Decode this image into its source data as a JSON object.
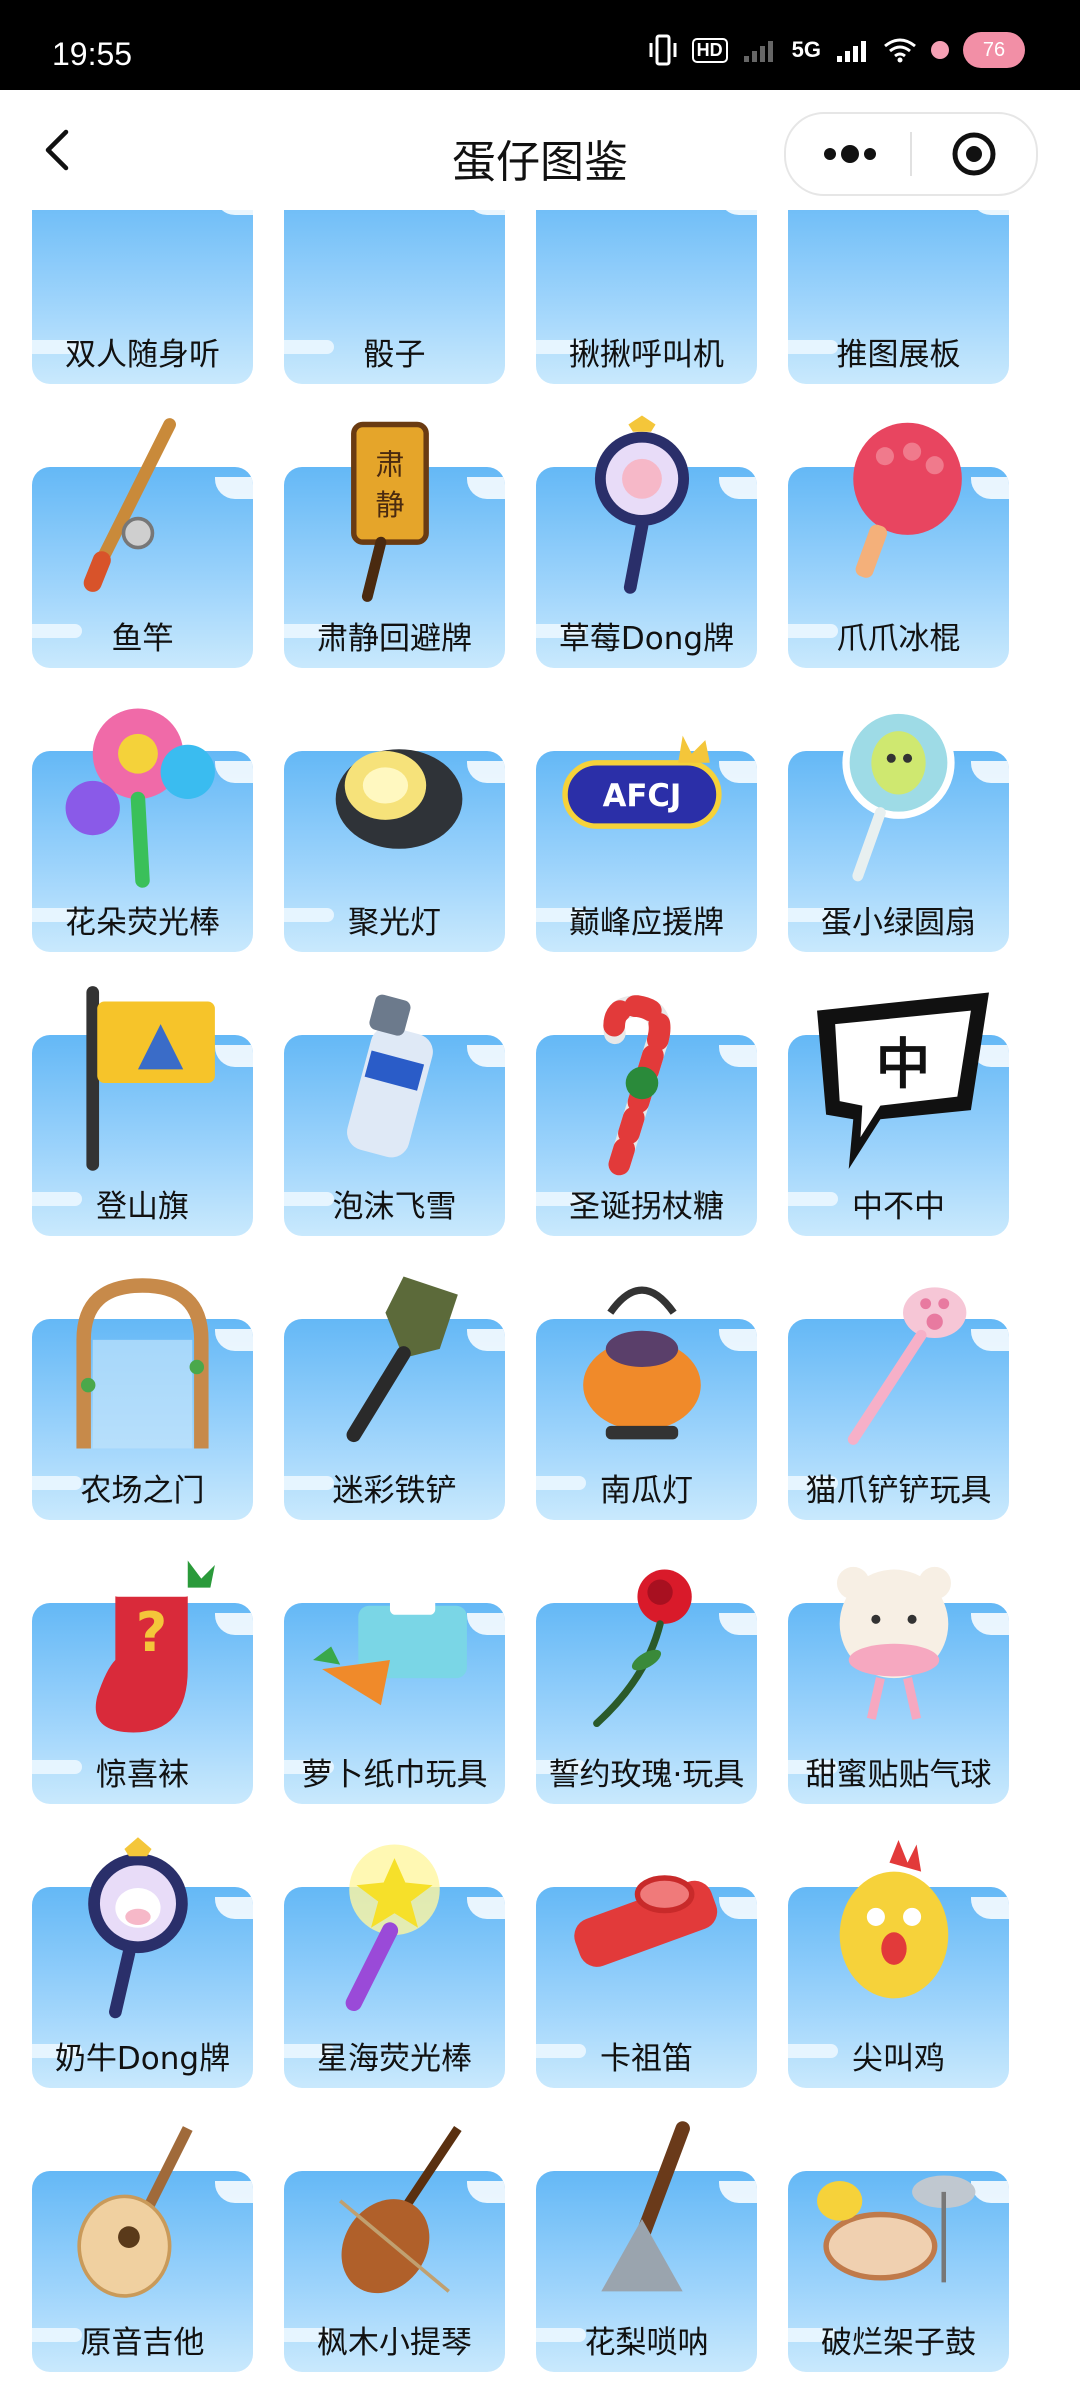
{
  "status_bar": {
    "time": "19:55",
    "hd_label": "HD",
    "network_label": "5G",
    "battery": "76"
  },
  "nav": {
    "title": "蛋仔图鉴"
  },
  "items": [
    {
      "label": "双人随身听",
      "icon": "earphones-icon"
    },
    {
      "label": "骰子",
      "icon": "dice-icon"
    },
    {
      "label": "揪揪呼叫机",
      "icon": "pager-icon"
    },
    {
      "label": "推图展板",
      "icon": "display-board-icon"
    },
    {
      "label": "鱼竿",
      "icon": "fishing-rod-icon"
    },
    {
      "label": "肃静回避牌",
      "icon": "silence-sign-icon"
    },
    {
      "label": "草莓Dong牌",
      "icon": "strawberry-dong-sign-icon"
    },
    {
      "label": "爪爪冰棍",
      "icon": "paw-popsicle-icon"
    },
    {
      "label": "花朵荧光棒",
      "icon": "flower-glowstick-icon"
    },
    {
      "label": "聚光灯",
      "icon": "spotlight-icon"
    },
    {
      "label": "巅峰应援牌",
      "icon": "cheer-sign-icon"
    },
    {
      "label": "蛋小绿圆扇",
      "icon": "round-fan-icon"
    },
    {
      "label": "登山旗",
      "icon": "mountain-flag-icon"
    },
    {
      "label": "泡沫飞雪",
      "icon": "foam-spray-icon"
    },
    {
      "label": "圣诞拐杖糖",
      "icon": "candy-cane-icon"
    },
    {
      "label": "中不中",
      "icon": "speech-bubble-icon"
    },
    {
      "label": "农场之门",
      "icon": "farm-gate-icon"
    },
    {
      "label": "迷彩铁铲",
      "icon": "camo-shovel-icon"
    },
    {
      "label": "南瓜灯",
      "icon": "pumpkin-lantern-icon"
    },
    {
      "label": "猫爪铲铲玩具",
      "icon": "cat-paw-scoop-icon"
    },
    {
      "label": "惊喜袜",
      "icon": "surprise-sock-icon"
    },
    {
      "label": "萝卜纸巾玩具",
      "icon": "carrot-tissue-icon"
    },
    {
      "label": "誓约玫瑰·玩具",
      "icon": "rose-icon"
    },
    {
      "label": "甜蜜贴贴气球",
      "icon": "bear-balloon-icon"
    },
    {
      "label": "奶牛Dong牌",
      "icon": "cow-dong-sign-icon"
    },
    {
      "label": "星海荧光棒",
      "icon": "star-glowstick-icon"
    },
    {
      "label": "卡祖笛",
      "icon": "kazoo-icon"
    },
    {
      "label": "尖叫鸡",
      "icon": "screaming-chicken-icon"
    },
    {
      "label": "原音吉他",
      "icon": "guitar-icon"
    },
    {
      "label": "枫木小提琴",
      "icon": "violin-icon"
    },
    {
      "label": "花梨唢呐",
      "icon": "suona-icon"
    },
    {
      "label": "破烂架子鼓",
      "icon": "drum-kit-icon"
    }
  ]
}
